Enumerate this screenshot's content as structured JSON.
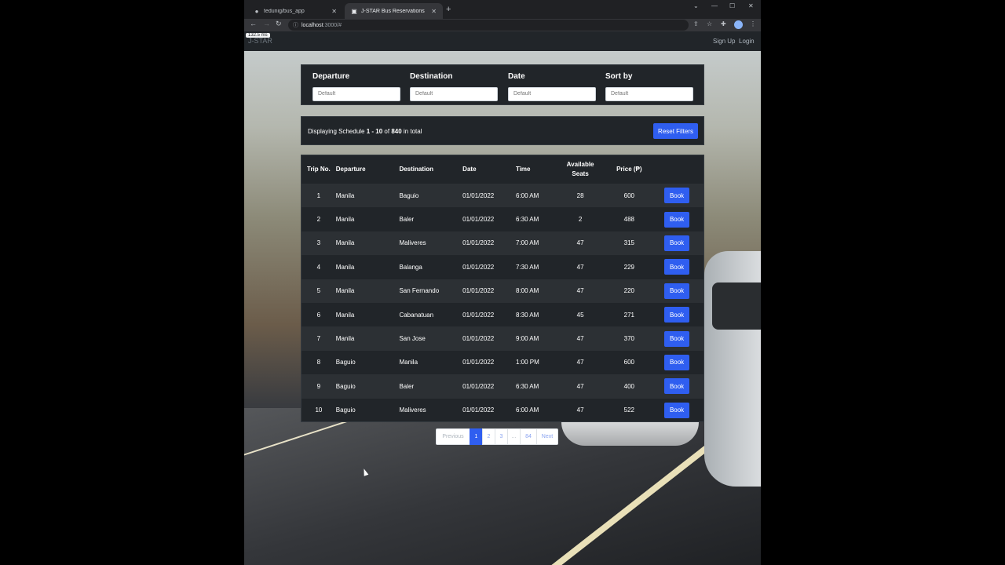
{
  "browser": {
    "tabs": [
      {
        "title": "tedunig/bus_app",
        "active": false
      },
      {
        "title": "J-STAR Bus Reservations",
        "active": true
      }
    ],
    "new_tab": "+",
    "url_host": "localhost",
    "url_path": ":3000/#",
    "loading_chip": "132.5 ms"
  },
  "navbar": {
    "brand": "J-STAR",
    "links": [
      "Sign Up",
      "Login"
    ]
  },
  "filters": [
    {
      "label": "Departure",
      "placeholder": "Default"
    },
    {
      "label": "Destination",
      "placeholder": "Default"
    },
    {
      "label": "Date",
      "placeholder": "Default"
    },
    {
      "label": "Sort by",
      "placeholder": "Default"
    }
  ],
  "summary": {
    "prefix": "Displaying Schedule ",
    "range": "1 - 10",
    "of": " of ",
    "total": "840",
    "suffix": " in total",
    "reset_label": "Reset Filters"
  },
  "table": {
    "headers": [
      "Trip No.",
      "Departure",
      "Destination",
      "Date",
      "Time",
      "Available Seats",
      "Price (₱)",
      ""
    ],
    "book_label": "Book",
    "rows": [
      [
        "1",
        "Manila",
        "Baguio",
        "01/01/2022",
        "6:00 AM",
        "28",
        "600"
      ],
      [
        "2",
        "Manila",
        "Baler",
        "01/01/2022",
        "6:30 AM",
        "2",
        "488"
      ],
      [
        "3",
        "Manila",
        "Maliveres",
        "01/01/2022",
        "7:00 AM",
        "47",
        "315"
      ],
      [
        "4",
        "Manila",
        "Balanga",
        "01/01/2022",
        "7:30 AM",
        "47",
        "229"
      ],
      [
        "5",
        "Manila",
        "San Fernando",
        "01/01/2022",
        "8:00 AM",
        "47",
        "220"
      ],
      [
        "6",
        "Manila",
        "Cabanatuan",
        "01/01/2022",
        "8:30 AM",
        "45",
        "271"
      ],
      [
        "7",
        "Manila",
        "San Jose",
        "01/01/2022",
        "9:00 AM",
        "47",
        "370"
      ],
      [
        "8",
        "Baguio",
        "Manila",
        "01/01/2022",
        "1:00 PM",
        "47",
        "600"
      ],
      [
        "9",
        "Baguio",
        "Baler",
        "01/01/2022",
        "6:30 AM",
        "47",
        "400"
      ],
      [
        "10",
        "Baguio",
        "Maliveres",
        "01/01/2022",
        "6:00 AM",
        "47",
        "522"
      ]
    ]
  },
  "pagination": {
    "previous": "Previous",
    "pages": [
      "1",
      "2",
      "3",
      "...",
      "84"
    ],
    "active_page": "1",
    "next": "Next"
  },
  "colors": {
    "accent": "#2f5ef0",
    "dark": "#212529"
  }
}
